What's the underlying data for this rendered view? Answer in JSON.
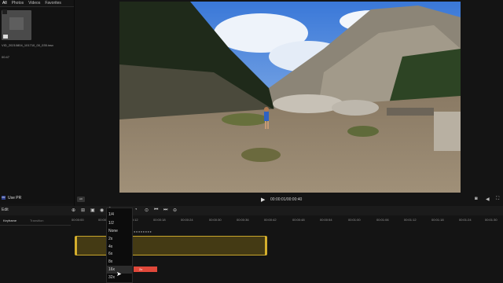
{
  "library": {
    "tabs": [
      "All",
      "Photos",
      "Videos",
      "Favorites"
    ],
    "clip": {
      "name": "VID_20210804_101710_00_035.insv",
      "duration": "00:47"
    },
    "use_pr_badge": "PR",
    "use_pr_label": "Use PR"
  },
  "player": {
    "hd_label": "HD",
    "timecode": "00:00:01/00:00:40",
    "icons": {
      "play": "play-icon",
      "camera": "camera-icon",
      "volume": "volume-icon",
      "fullscreen": "fullscreen-icon"
    }
  },
  "edit": {
    "label": "Edit",
    "speed_current": "2x",
    "speed_options": [
      "1/4",
      "1/2",
      "None",
      "2x",
      "4x",
      "6x",
      "8x",
      "16x",
      "32x"
    ],
    "speed_selected": "16x",
    "selected_red_label": "2x",
    "sub_tabs": [
      "Keyframe",
      "Transition"
    ],
    "ruler": [
      "00:00:00",
      "00:00:06",
      "00:00:12",
      "00:00:18",
      "00:00:24",
      "00:00:30",
      "00:00:36",
      "00:00:42",
      "00:00:48",
      "00:00:54",
      "00:01:00",
      "00:01:06",
      "00:01:12",
      "00:01:18",
      "00:01:24",
      "00:01:30"
    ]
  },
  "colors": {
    "accent": "#c9a52a",
    "speed_bar": "#e0483a",
    "badge": "#2e3f8f"
  }
}
